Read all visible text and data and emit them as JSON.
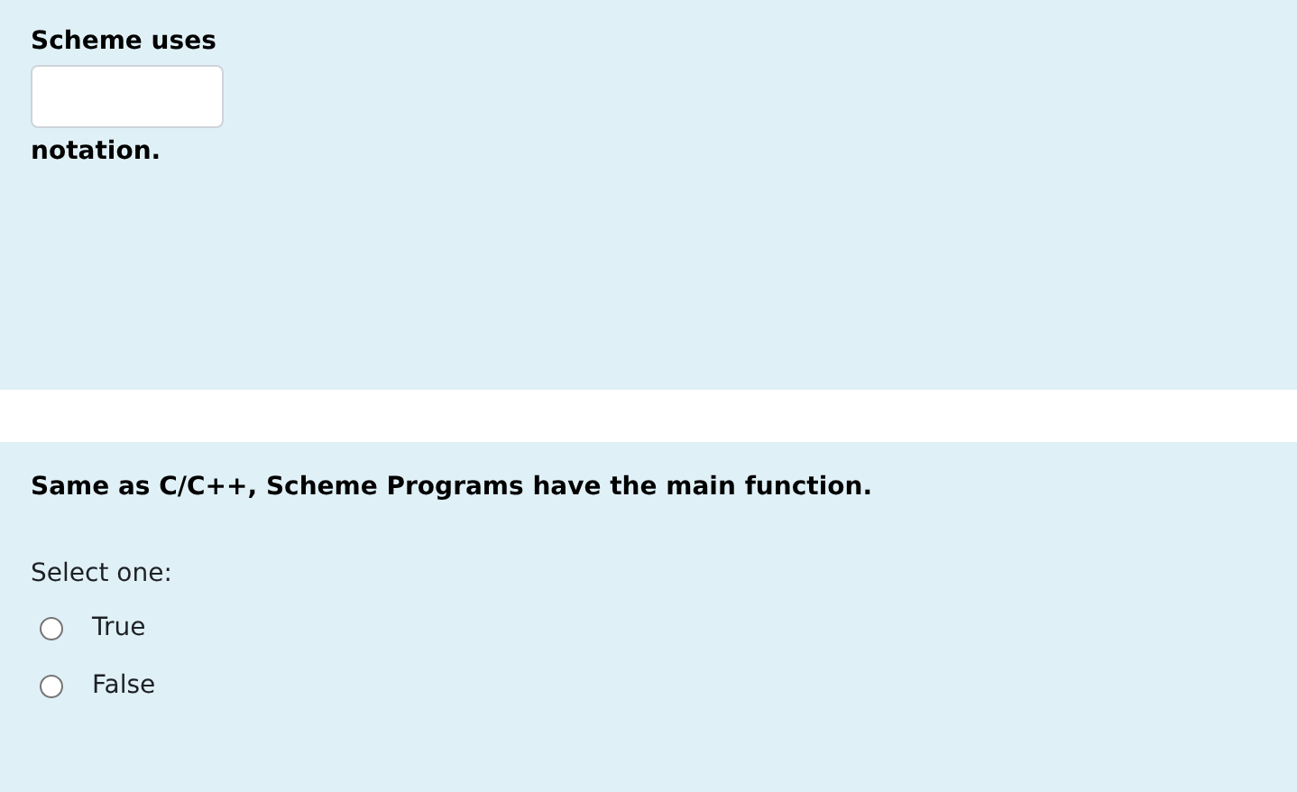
{
  "questions": [
    {
      "kind": "fill_in",
      "text_before": "Scheme uses",
      "text_after": "notation."
    },
    {
      "kind": "choice",
      "text": "Same as C/C++, Scheme Programs have the main function.",
      "prompt": "Select one:",
      "options": [
        {
          "label": "True",
          "selected": false
        },
        {
          "label": "False",
          "selected": false
        }
      ]
    }
  ]
}
